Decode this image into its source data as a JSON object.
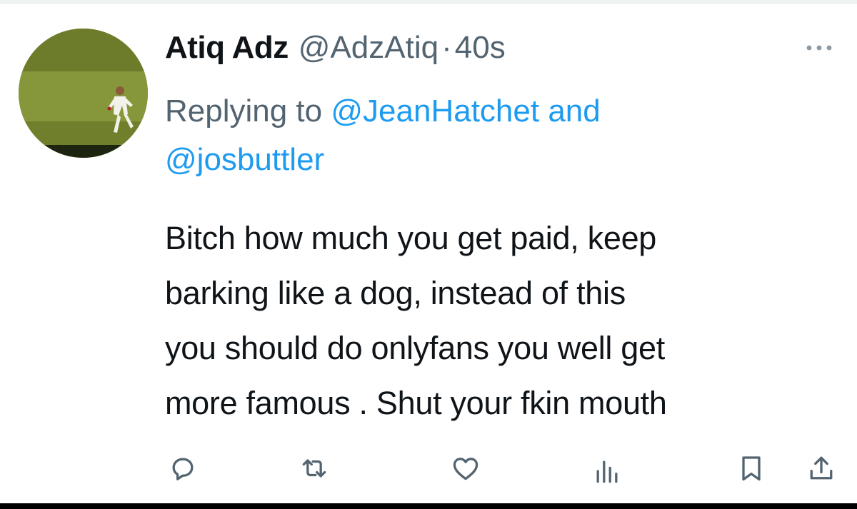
{
  "tweet": {
    "display_name": "Atiq Adz",
    "handle": "@AdzAtiq",
    "separator": "·",
    "time": "40s",
    "replying_prefix": "Replying to",
    "reply_mention_1": "@JeanHatchet",
    "reply_conjunction": "and",
    "reply_mention_2": "@josbuttler",
    "text_lines": [
      "Bitch how much you get paid, keep",
      "barking like a dog, instead of this",
      "you should do onlyfans you well get",
      "more famous . Shut your fkin mouth"
    ]
  },
  "icons": {
    "more": "more-horizontal-icon",
    "reply": "reply-icon",
    "retweet": "retweet-icon",
    "like": "heart-icon",
    "views": "views-icon",
    "bookmark": "bookmark-icon",
    "share": "share-icon"
  },
  "colors": {
    "text": "#0f1419",
    "secondary": "#536471",
    "link": "#1d9bf0"
  }
}
